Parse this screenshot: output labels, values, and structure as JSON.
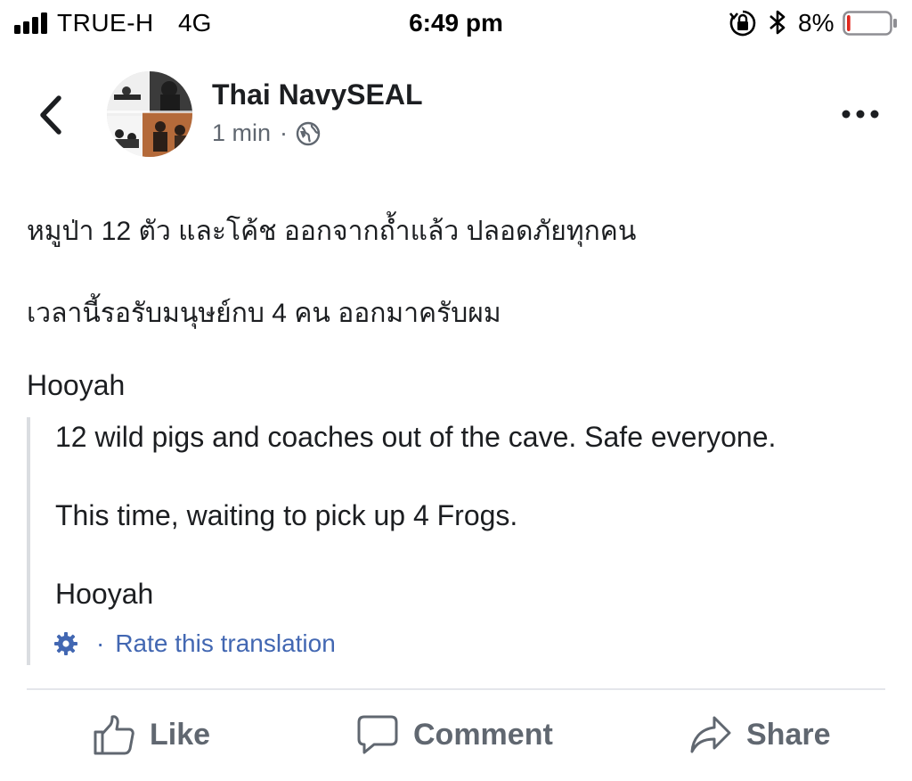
{
  "status_bar": {
    "carrier": "TRUE-H",
    "network": "4G",
    "time": "6:49 pm",
    "battery_percent": "8%",
    "battery_level": 0.08,
    "icons": [
      "signal-bars-icon",
      "rotation-lock-icon",
      "bluetooth-icon",
      "battery-icon"
    ]
  },
  "header": {
    "page_name": "Thai NavySEAL",
    "time_ago": "1 min",
    "separator": "·",
    "privacy_icon": "globe-icon"
  },
  "post": {
    "lines": [
      "หมูป่า 12 ตัว และโค้ช ออกจากถ้ำแล้ว ปลอดภัยทุกคน",
      "เวลานี้รอรับมนุษย์กบ 4 คน ออกมาครับผม",
      "Hooyah"
    ]
  },
  "translation": {
    "lines": [
      "12 wild pigs and coaches out of the cave. Safe everyone.",
      "This time, waiting to pick up 4 Frogs.",
      "Hooyah"
    ],
    "separator": "·",
    "rate_label": "Rate this translation"
  },
  "actions": {
    "like": "Like",
    "comment": "Comment",
    "share": "Share"
  },
  "colors": {
    "link_blue": "#4267b2",
    "secondary_text": "#606770",
    "battery_low": "#e0281e"
  }
}
